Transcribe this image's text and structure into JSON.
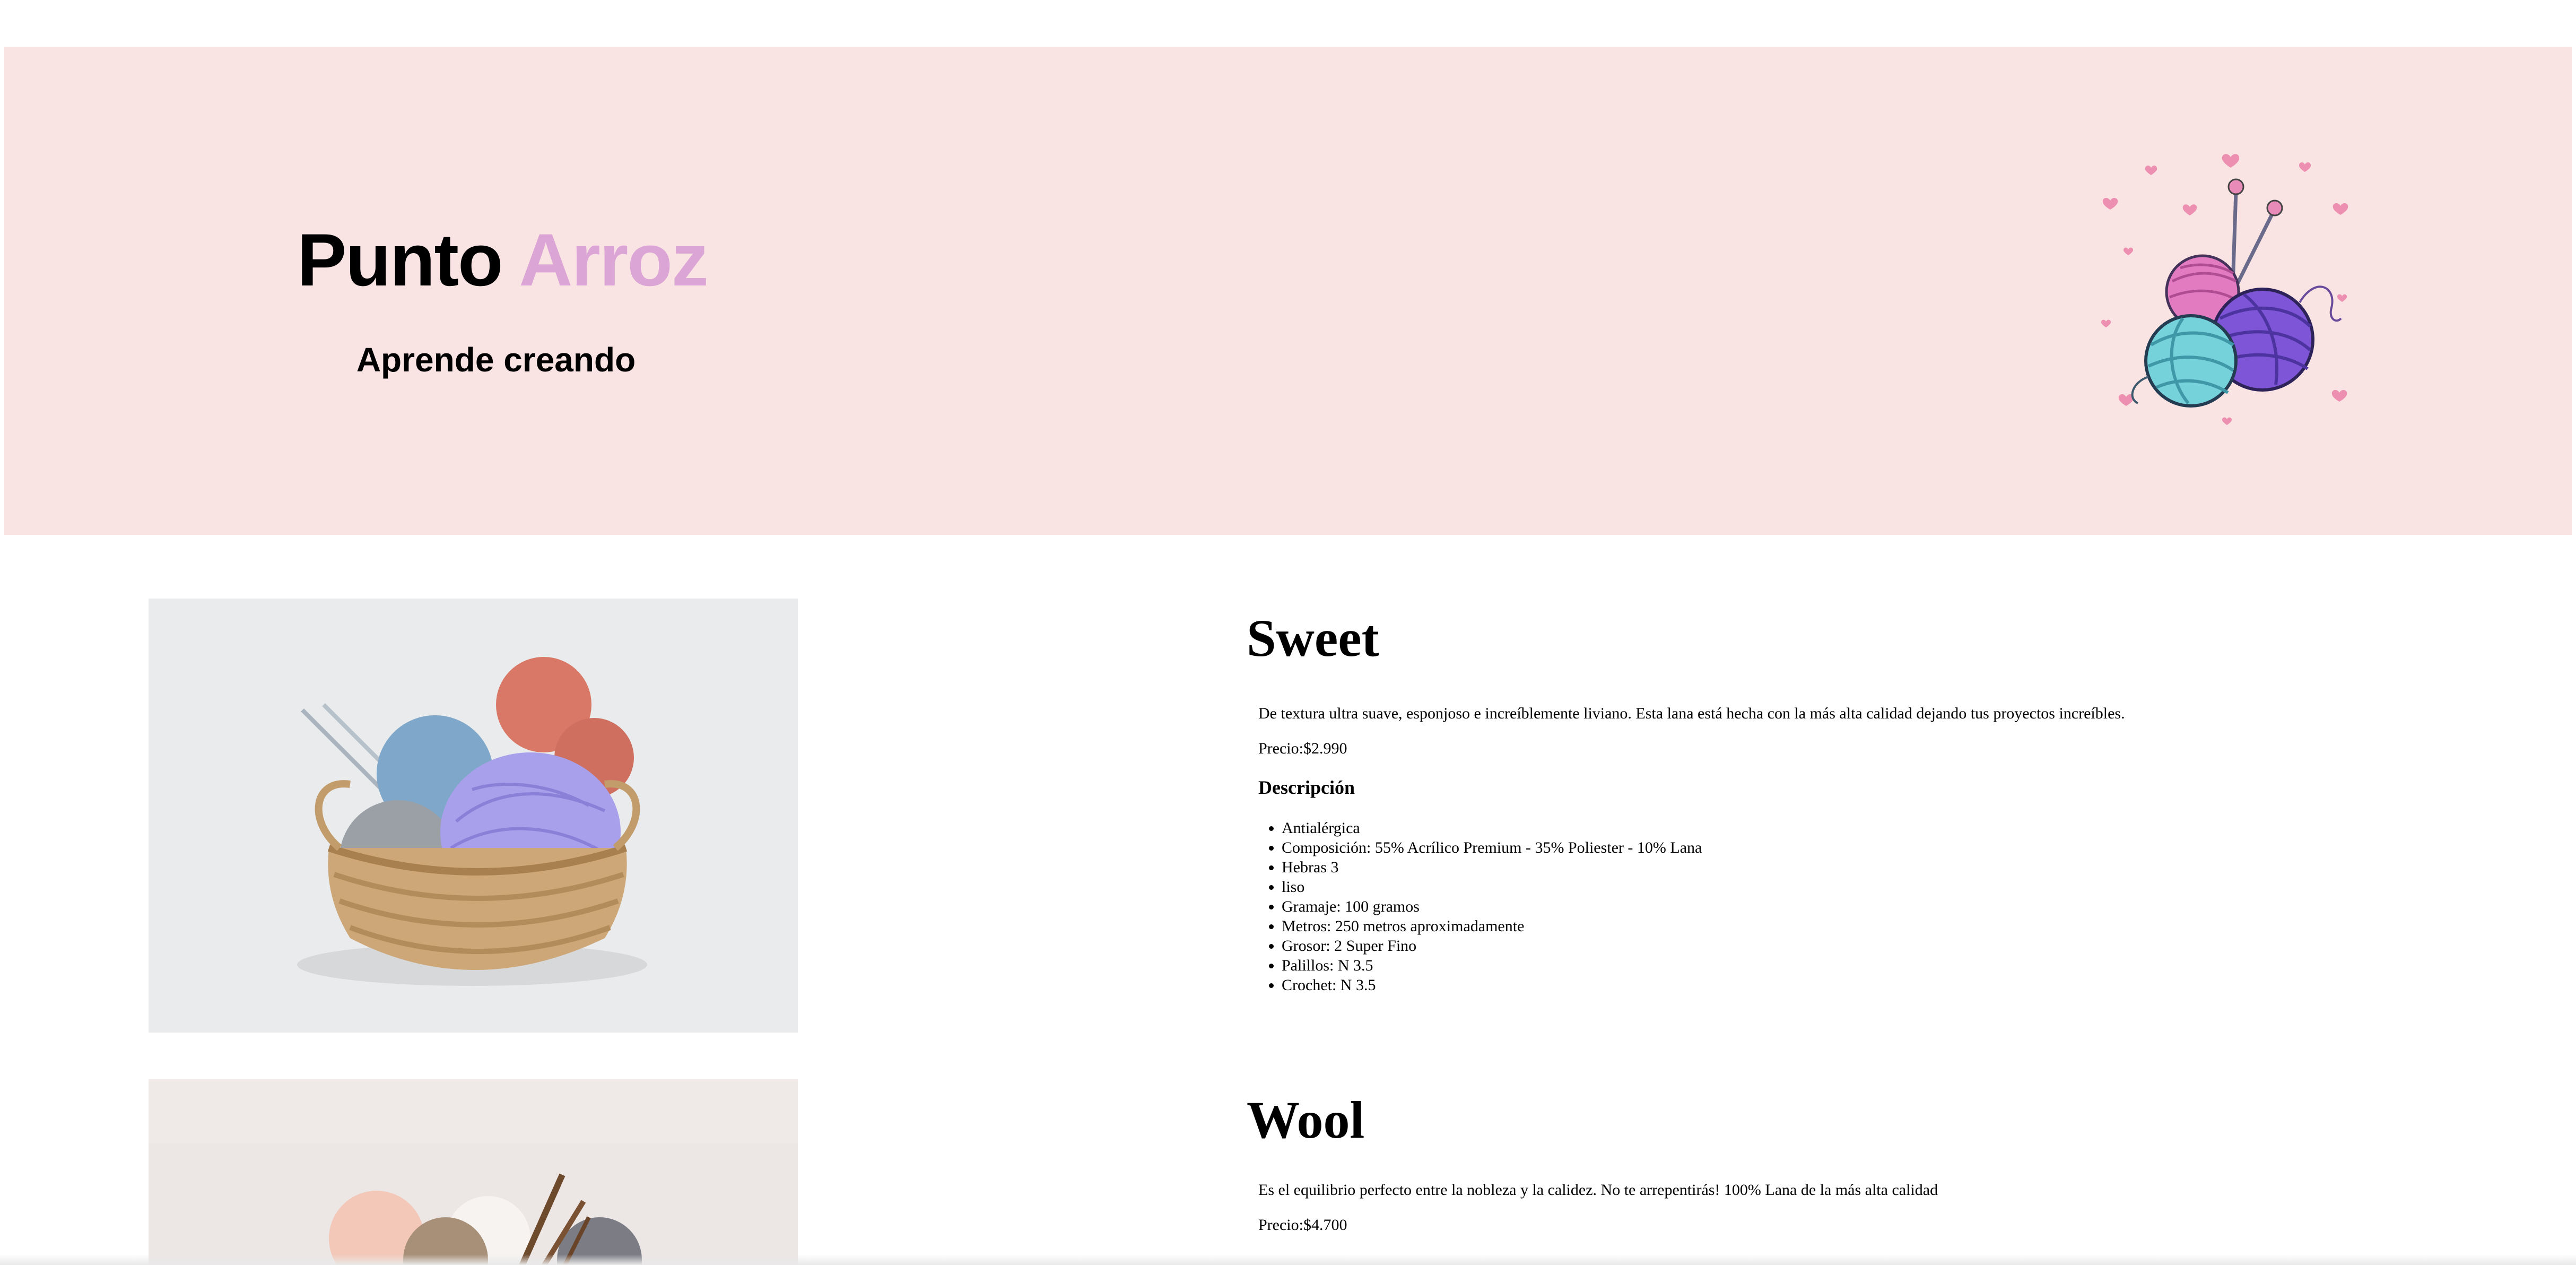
{
  "header": {
    "brand_word1": "Punto",
    "brand_word2": "Arroz",
    "tagline": "Aprende creando",
    "banner_color": "#f9e4e3",
    "brand_accent_color": "#dba5d6",
    "logo_icon": "yarn-balls-knitting-needles-hearts-icon"
  },
  "products": [
    {
      "name": "Sweet",
      "description": "De textura ultra suave, esponjoso e increíblemente liviano. Esta lana está hecha con la más alta calidad dejando tus proyectos increíbles.",
      "price": "Precio:$2.990",
      "details_title": "Descripción",
      "details": [
        "Antialérgica",
        "Composición: 55% Acrílico Premium - 35% Poliester - 10% Lana",
        "Hebras 3",
        "liso",
        "Gramaje: 100 gramos",
        "Metros: 250 metros aproximadamente",
        "Grosor: 2 Super Fino",
        "Palillos: N 3.5",
        "Crochet: N 3.5"
      ]
    },
    {
      "name": "Wool",
      "description": "Es el equilibrio perfecto entre la nobleza y la calidez. No te arrepentirás! 100% Lana de la más alta calidad",
      "price": "Precio:$4.700"
    }
  ]
}
